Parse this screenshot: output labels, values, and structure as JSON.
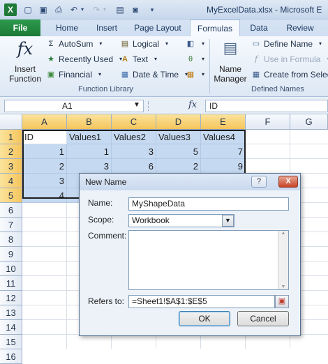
{
  "window": {
    "title": "MyExcelData.xlsx - Microsoft E",
    "app_icon": "X"
  },
  "quick_access": {
    "icons": [
      "new-document-icon",
      "save-icon",
      "print-preview-icon",
      "undo-icon",
      "redo-icon",
      "form-icon",
      "camera-icon",
      "customize-qat-icon"
    ]
  },
  "tabs": [
    "File",
    "Home",
    "Insert",
    "Page Layout",
    "Formulas",
    "Data",
    "Review"
  ],
  "ribbon": {
    "insert_function": {
      "line1": "Insert",
      "line2": "Function"
    },
    "library": {
      "autosum": "AutoSum",
      "recently_used": "Recently Used",
      "financial": "Financial",
      "logical": "Logical",
      "text": "Text",
      "date_time": "Date & Time",
      "group_label": "Function Library"
    },
    "name_manager": {
      "line1": "Name",
      "line2": "Manager"
    },
    "defined_names": {
      "define_name": "Define Name",
      "use_in_formula": "Use in Formula",
      "create_from_selection": "Create from Select",
      "group_label": "Defined Names"
    }
  },
  "formula_bar": {
    "name_box": "A1",
    "fx_label": "fx",
    "formula": "ID"
  },
  "sheet": {
    "columns": [
      "A",
      "B",
      "C",
      "D",
      "E",
      "F",
      "G"
    ],
    "rows": [
      "1",
      "2",
      "3",
      "4",
      "5",
      "6",
      "7",
      "8",
      "9",
      "10",
      "11",
      "12",
      "13",
      "14",
      "15",
      "16"
    ],
    "header_row": [
      "ID",
      "Values1",
      "Values2",
      "Values3",
      "Values4"
    ],
    "data_rows": [
      [
        "1",
        "1",
        "3",
        "5",
        "7"
      ],
      [
        "2",
        "3",
        "6",
        "2",
        "9"
      ],
      [
        "3",
        "",
        "",
        "",
        ""
      ],
      [
        "4",
        "",
        "",
        "",
        ""
      ]
    ]
  },
  "dialog": {
    "title": "New Name",
    "help": "?",
    "close": "X",
    "name_label": "Name:",
    "name_value": "MyShapeData",
    "scope_label": "Scope:",
    "scope_value": "Workbook",
    "comment_label": "Comment:",
    "comment_value": "",
    "refers_label": "Refers to:",
    "refers_value": "=Sheet1!$A$1:$E$5",
    "ok": "OK",
    "cancel": "Cancel"
  }
}
